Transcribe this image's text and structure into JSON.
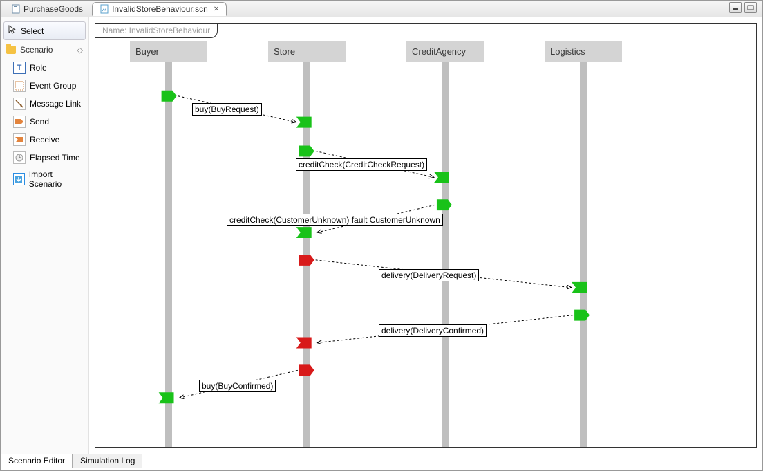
{
  "tabs": {
    "purchaseGoods": "PurchaseGoods",
    "invalidStore": "InvalidStoreBehaviour.scn"
  },
  "palette": {
    "select": "Select",
    "groupTitle": "Scenario",
    "items": {
      "role": "Role",
      "eventGroup": "Event Group",
      "messageLink": "Message Link",
      "send": "Send",
      "receive": "Receive",
      "elapsedTime": "Elapsed Time",
      "importScenario": "Import Scenario"
    }
  },
  "canvas": {
    "nameLabel": "Name: InvalidStoreBehaviour"
  },
  "roles": {
    "buyer": "Buyer",
    "store": "Store",
    "creditAgency": "CreditAgency",
    "logistics": "Logistics"
  },
  "messages": {
    "m1": "buy(BuyRequest)",
    "m2": "creditCheck(CreditCheckRequest)",
    "m3": "creditCheck(CustomerUnknown) fault CustomerUnknown",
    "m4": "delivery(DeliveryRequest)",
    "m5": "delivery(DeliveryConfirmed)",
    "m6": "buy(BuyConfirmed)"
  },
  "bottomTabs": {
    "editor": "Scenario Editor",
    "log": "Simulation Log"
  },
  "chart_data": {
    "type": "sequence-diagram",
    "participants": [
      "Buyer",
      "Store",
      "CreditAgency",
      "Logistics"
    ],
    "events": [
      {
        "from": "Buyer",
        "to": "Store",
        "label": "buy(BuyRequest)",
        "sendStatus": "ok",
        "receiveStatus": "ok"
      },
      {
        "from": "Store",
        "to": "CreditAgency",
        "label": "creditCheck(CreditCheckRequest)",
        "sendStatus": "ok",
        "receiveStatus": "ok"
      },
      {
        "from": "CreditAgency",
        "to": "Store",
        "label": "creditCheck(CustomerUnknown) fault CustomerUnknown",
        "sendStatus": "ok",
        "receiveStatus": "ok"
      },
      {
        "from": "Store",
        "to": "Logistics",
        "label": "delivery(DeliveryRequest)",
        "sendStatus": "error",
        "receiveStatus": "ok"
      },
      {
        "from": "Logistics",
        "to": "Store",
        "label": "delivery(DeliveryConfirmed)",
        "sendStatus": "ok",
        "receiveStatus": "error"
      },
      {
        "from": "Store",
        "to": "Buyer",
        "label": "buy(BuyConfirmed)",
        "sendStatus": "error",
        "receiveStatus": "ok"
      }
    ]
  }
}
